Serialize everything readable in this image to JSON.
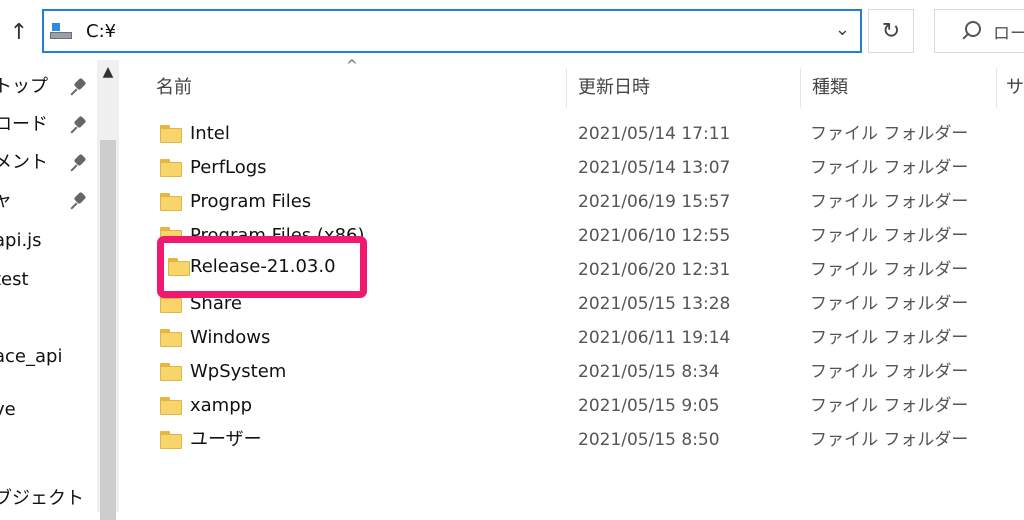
{
  "address_bar": {
    "path": "C:¥"
  },
  "search": {
    "placeholder": "ロー"
  },
  "nav": {
    "items": [
      {
        "label": "トップ",
        "pinned": true
      },
      {
        "label": "ロード",
        "pinned": true
      },
      {
        "label": "メント",
        "pinned": true
      },
      {
        "label": "ャ",
        "pinned": true
      },
      {
        "label": "api.js",
        "pinned": false
      },
      {
        "label": "test",
        "pinned": false
      },
      {
        "label": "ace_api",
        "pinned": false
      },
      {
        "label": "ve",
        "pinned": false
      },
      {
        "label": "ブジェクト",
        "pinned": false
      }
    ]
  },
  "columns": {
    "name": "名前",
    "date": "更新日時",
    "type": "種類",
    "size": "サ"
  },
  "files": [
    {
      "name": "Intel",
      "date": "2021/05/14 17:11",
      "type": "ファイル フォルダー"
    },
    {
      "name": "PerfLogs",
      "date": "2021/05/14 13:07",
      "type": "ファイル フォルダー"
    },
    {
      "name": "Program Files",
      "date": "2021/06/19 15:57",
      "type": "ファイル フォルダー"
    },
    {
      "name": "Program Files (x86)",
      "date": "2021/06/10 12:55",
      "type": "ファイル フォルダー"
    },
    {
      "name": "Release-21.03.0",
      "date": "2021/06/20 12:31",
      "type": "ファイル フォルダー"
    },
    {
      "name": "Share",
      "date": "2021/05/15 13:28",
      "type": "ファイル フォルダー"
    },
    {
      "name": "Windows",
      "date": "2021/06/11 19:14",
      "type": "ファイル フォルダー"
    },
    {
      "name": "WpSystem",
      "date": "2021/05/15 8:34",
      "type": "ファイル フォルダー"
    },
    {
      "name": "xampp",
      "date": "2021/05/15 9:05",
      "type": "ファイル フォルダー"
    },
    {
      "name": "ユーザー",
      "date": "2021/05/15 8:50",
      "type": "ファイル フォルダー"
    }
  ],
  "highlight": {
    "label": "Release-21.03.0",
    "color": "#f0196f"
  },
  "icons": {
    "up": "up-arrow-icon",
    "drive": "drive-icon",
    "dropdown": "chevron-down-icon",
    "refresh": "refresh-icon",
    "search": "search-icon",
    "pin": "pin-icon",
    "folder": "folder-icon",
    "sort": "sort-ascending-icon"
  }
}
